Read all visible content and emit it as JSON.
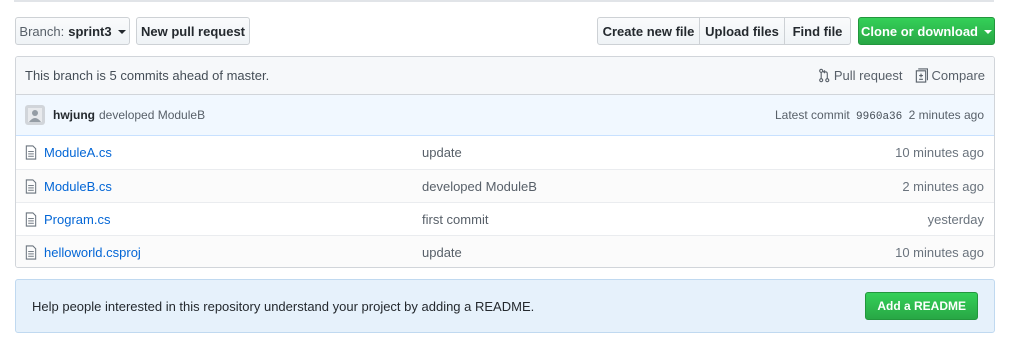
{
  "toolbar": {
    "branch_prefix": "Branch:",
    "branch_name": "sprint3",
    "new_pull_request": "New pull request",
    "create_new_file": "Create new file",
    "upload_files": "Upload files",
    "find_file": "Find file",
    "clone_or_download": "Clone or download"
  },
  "branch_info": {
    "message": "This branch is 5 commits ahead of master.",
    "pull_request": "Pull request",
    "compare": "Compare"
  },
  "latest_commit": {
    "author": "hwjung",
    "message": "developed ModuleB",
    "latest_label": "Latest commit",
    "sha": "9960a36",
    "age": "2 minutes ago"
  },
  "files": [
    {
      "name": "ModuleA.cs",
      "message": "update",
      "age": "10 minutes ago"
    },
    {
      "name": "ModuleB.cs",
      "message": "developed ModuleB",
      "age": "2 minutes ago"
    },
    {
      "name": "Program.cs",
      "message": "first commit",
      "age": "yesterday"
    },
    {
      "name": "helloworld.csproj",
      "message": "update",
      "age": "10 minutes ago"
    }
  ],
  "readme_prompt": {
    "text": "Help people interested in this repository understand your project by adding a README.",
    "button": "Add a README"
  },
  "colors": {
    "link": "#0366d6",
    "green": "#28a745",
    "commit_bar_bg": "#f1f8ff",
    "readme_bg": "#e6f1fb"
  },
  "icons": {
    "file": "file-icon",
    "pull_request": "git-pull-request-icon",
    "compare": "diff-icon",
    "caret": "caret-down-icon"
  }
}
